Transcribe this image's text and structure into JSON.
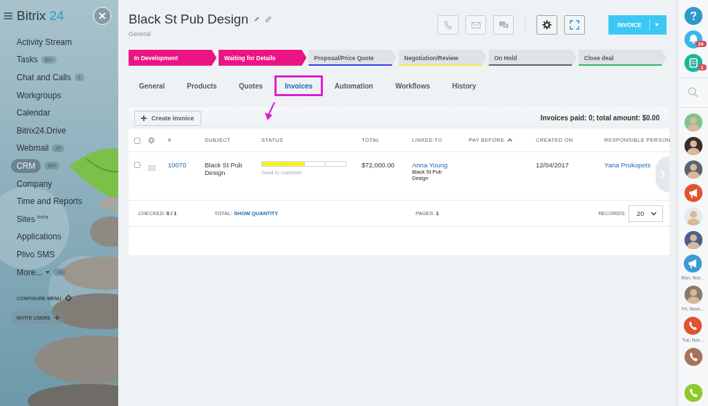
{
  "sidebar": {
    "logo": "Bitrix",
    "logo_suffix": "24",
    "items": [
      {
        "label": "Activity Stream",
        "selected": false
      },
      {
        "label": "Tasks",
        "counter": "50+",
        "selected": false
      },
      {
        "label": "Chat and Calls",
        "counter": "1",
        "selected": false
      },
      {
        "label": "Workgroups",
        "selected": false
      },
      {
        "label": "Calendar",
        "selected": false
      },
      {
        "label": "Bitrix24.Drive",
        "selected": false
      },
      {
        "label": "Webmail",
        "counter": "47",
        "selected": false
      },
      {
        "label": "CRM",
        "counter": "50+",
        "selected": true
      },
      {
        "label": "Company",
        "selected": false
      },
      {
        "label": "Time and Reports",
        "selected": false
      },
      {
        "label": "Sites $^{beta}$",
        "selected": false
      },
      {
        "label": "Applications",
        "selected": false
      },
      {
        "label": "Plivo SMS",
        "selected": false
      },
      {
        "label": "More...",
        "counter": "24",
        "dropdown": true,
        "selected": false
      }
    ],
    "configure": "CONFIGURE MENU",
    "invite": "INVITE USERS"
  },
  "header": {
    "title": "Black St Pub Design",
    "subtitle": "General",
    "action": "INVOICE"
  },
  "stages": [
    {
      "label": "In Development",
      "done": true,
      "color": "#ea1484"
    },
    {
      "label": "Waiting for Details",
      "done": true,
      "color": "#ea1484"
    },
    {
      "label": "Proposal/Price Quote",
      "done": false,
      "color": "#2e3fe6"
    },
    {
      "label": "Negotiation/Review",
      "done": false,
      "color": "#f2ea35"
    },
    {
      "label": "On Hold",
      "done": false,
      "color": "#5b5e62"
    },
    {
      "label": "Close deal",
      "done": false,
      "color": "#2fb45c"
    }
  ],
  "tabs": [
    {
      "label": "General",
      "selected": false,
      "highlighted": false
    },
    {
      "label": "Products",
      "selected": false,
      "highlighted": false
    },
    {
      "label": "Quotes",
      "selected": false,
      "highlighted": false
    },
    {
      "label": "Invoices",
      "selected": true,
      "highlighted": true
    },
    {
      "label": "Automation",
      "selected": false,
      "highlighted": false
    },
    {
      "label": "Workflows",
      "selected": false,
      "highlighted": false
    },
    {
      "label": "History",
      "selected": false,
      "highlighted": false
    }
  ],
  "invoices": {
    "create": "Create invoice",
    "select_all": {
      "checked": false
    },
    "summary": "Invoices paid: 0; total amount: $0.00",
    "columns": [
      {
        "label": "#",
        "sorted": false
      },
      {
        "label": "SUBJECT",
        "sorted": false
      },
      {
        "label": "STATUS",
        "sorted": false
      },
      {
        "label": "TOTAL",
        "sorted": false
      },
      {
        "label": "LINKED TO",
        "sorted": false
      },
      {
        "label": "PAY BEFORE",
        "sorted": true
      },
      {
        "label": "CREATED ON",
        "sorted": false
      },
      {
        "label": "RESPONSIBLE PERSON",
        "sorted": false
      }
    ],
    "rows": [
      {
        "checked": false,
        "number": "10070",
        "subject": "Black St Pub Design",
        "level": 0.5,
        "status": "Send to customer",
        "total": "$72,000.00",
        "contact": "Anna Young",
        "company": "Black St Pub Design",
        "created": "12/04/2017",
        "responsible": "Yana Prokopets"
      }
    ],
    "footer": {
      "checked_label": "CHECKED:",
      "checked": "0 / 1",
      "total_label": "TOTAL:",
      "total_link": "SHOW QUANTITY",
      "pages_label": "PAGES:",
      "pages": "1",
      "records_label": "RECORDS:",
      "records": "20"
    }
  },
  "rightbar": [
    {
      "kind": "help",
      "color": "#2f9ac9"
    },
    {
      "kind": "bell",
      "color": "#3bb7e8",
      "counter": "24"
    },
    {
      "kind": "chat",
      "color": "#1fb39a",
      "counter": "1"
    },
    {
      "kind": "search"
    },
    {
      "kind": "avatar",
      "color": "#7fc58a"
    },
    {
      "kind": "avatar",
      "color": "#3a2e2a"
    },
    {
      "kind": "avatar",
      "color": "#5b6470"
    },
    {
      "kind": "megaphone",
      "color": "#e2532f"
    },
    {
      "kind": "avatar",
      "color": "#e6e8ea"
    },
    {
      "kind": "avatar",
      "color": "#4a5f8a"
    },
    {
      "kind": "megaphone",
      "color": "#3a9bd5",
      "caption": "Mon, Nov…"
    },
    {
      "kind": "avatar",
      "color": "#8a7a6a",
      "caption": "Fri, Nove…"
    },
    {
      "kind": "phone",
      "color": "#e2532f",
      "caption": "Tue, Nov…"
    },
    {
      "kind": "phone",
      "color": "#a8735d"
    },
    {
      "kind": "call",
      "color": "#8dcb2b"
    }
  ]
}
